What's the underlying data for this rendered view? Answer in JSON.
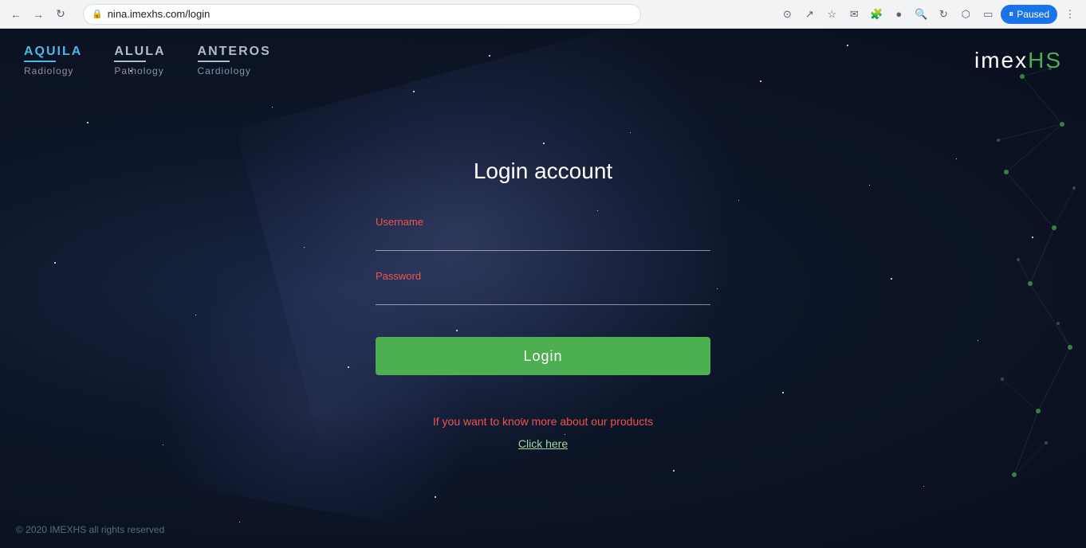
{
  "browser": {
    "url": "nina.imexhs.com/login",
    "paused_label": "Paused"
  },
  "header": {
    "products": [
      {
        "name": "AQUILA",
        "sub": "Radiology",
        "class": "product-aquila"
      },
      {
        "name": "ALULA",
        "sub": "Pathology",
        "class": "product-alula"
      },
      {
        "name": "ANTEROS",
        "sub": "Cardiology",
        "class": "product-anteros"
      }
    ],
    "logo_prefix": "imex",
    "logo_suffix": "HS"
  },
  "login": {
    "title": "Login account",
    "username_label": "Username",
    "password_label": "Password",
    "login_button": "Login",
    "info_text": "If you want to know more about our products",
    "click_here": "Click here"
  },
  "footer": {
    "copyright": "© 2020 IMEXHS all rights reserved"
  }
}
